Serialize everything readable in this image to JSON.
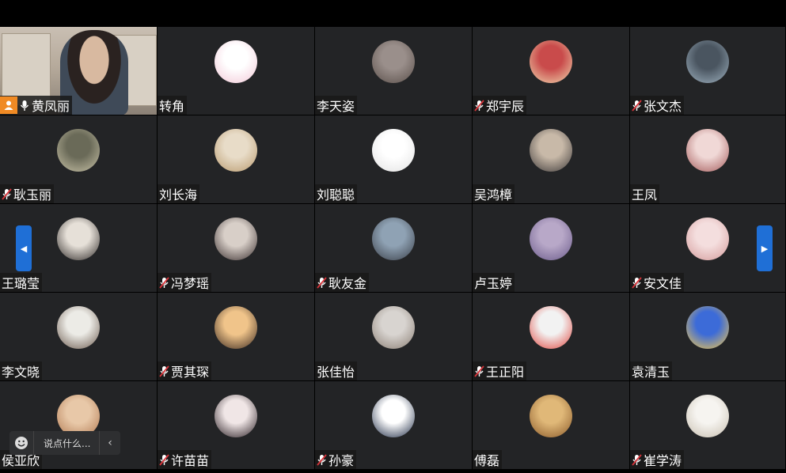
{
  "participants": [
    {
      "name": "黄凤丽",
      "video": true,
      "host": true,
      "muted": false
    },
    {
      "name": "转角",
      "muted": false,
      "avatar": [
        "#ffffff",
        "#f2c7d6"
      ]
    },
    {
      "name": "李天姿",
      "muted": false,
      "avatar": [
        "#9a8f8b",
        "#5a4f4a"
      ]
    },
    {
      "name": "郑宇辰",
      "muted": true,
      "avatar": [
        "#c94b4b",
        "#f0d9b0"
      ]
    },
    {
      "name": "张文杰",
      "muted": true,
      "avatar": [
        "#4a5560",
        "#9fb2c0"
      ]
    },
    {
      "name": "耿玉丽",
      "muted": true,
      "avatar": [
        "#6a6a58",
        "#c9c3a8"
      ]
    },
    {
      "name": "刘长海",
      "muted": false,
      "avatar": [
        "#e8dcc8",
        "#b99a6e"
      ]
    },
    {
      "name": "刘聪聪",
      "muted": false,
      "avatar": [
        "#ffffff",
        "#e3e3e3"
      ]
    },
    {
      "name": "吴鸿樟",
      "muted": false,
      "avatar": [
        "#c8b9a8",
        "#3e3a3a"
      ]
    },
    {
      "name": "王凤",
      "muted": false,
      "avatar": [
        "#f0d8d6",
        "#a45a5a"
      ]
    },
    {
      "name": "王璐莹",
      "muted": false,
      "avatar": [
        "#e6e0d8",
        "#2f2a28"
      ]
    },
    {
      "name": "冯梦瑶",
      "muted": true,
      "avatar": [
        "#d8cfc8",
        "#3b3030"
      ]
    },
    {
      "name": "耿友金",
      "muted": true,
      "avatar": [
        "#8fa2b4",
        "#3a3f48"
      ]
    },
    {
      "name": "卢玉婷",
      "muted": false,
      "avatar": [
        "#b8a8c8",
        "#6a5a8a"
      ]
    },
    {
      "name": "安文佳",
      "muted": true,
      "avatar": [
        "#f4dede",
        "#d49a9a"
      ]
    },
    {
      "name": "李文晓",
      "muted": false,
      "avatar": [
        "#ecebe6",
        "#6b5a4e"
      ]
    },
    {
      "name": "贾其琛",
      "muted": true,
      "avatar": [
        "#f0c48a",
        "#3c2a20"
      ]
    },
    {
      "name": "张佳怡",
      "muted": false,
      "avatar": [
        "#d8d4d0",
        "#8a7e74"
      ]
    },
    {
      "name": "王正阳",
      "muted": true,
      "avatar": [
        "#f2f2f2",
        "#e0463e"
      ]
    },
    {
      "name": "袁清玉",
      "muted": false,
      "avatar": [
        "#3c6bd8",
        "#f5c94a"
      ]
    },
    {
      "name": "侯亚欣",
      "muted": false,
      "avatar": [
        "#e8c8a8",
        "#b07850"
      ]
    },
    {
      "name": "许苗苗",
      "muted": true,
      "avatar": [
        "#f0e6e6",
        "#2a1f24"
      ]
    },
    {
      "name": "孙豪",
      "muted": true,
      "avatar": [
        "#ffffff",
        "#1d2a44"
      ]
    },
    {
      "name": "傅磊",
      "muted": false,
      "avatar": [
        "#e0b878",
        "#8a5a2a"
      ]
    },
    {
      "name": "崔学涛",
      "muted": true,
      "avatar": [
        "#f6f4f0",
        "#c8bfb0"
      ]
    }
  ],
  "chat": {
    "placeholder": "说点什么...",
    "emoji_icon": "smile-icon",
    "collapse_icon": "chevron-left-icon"
  },
  "nav": {
    "prev": "◀",
    "next": "▶"
  },
  "colors": {
    "tile": "#232426",
    "host": "#f08a24",
    "accent": "#1f6fd6",
    "mute": "#d9343a"
  }
}
